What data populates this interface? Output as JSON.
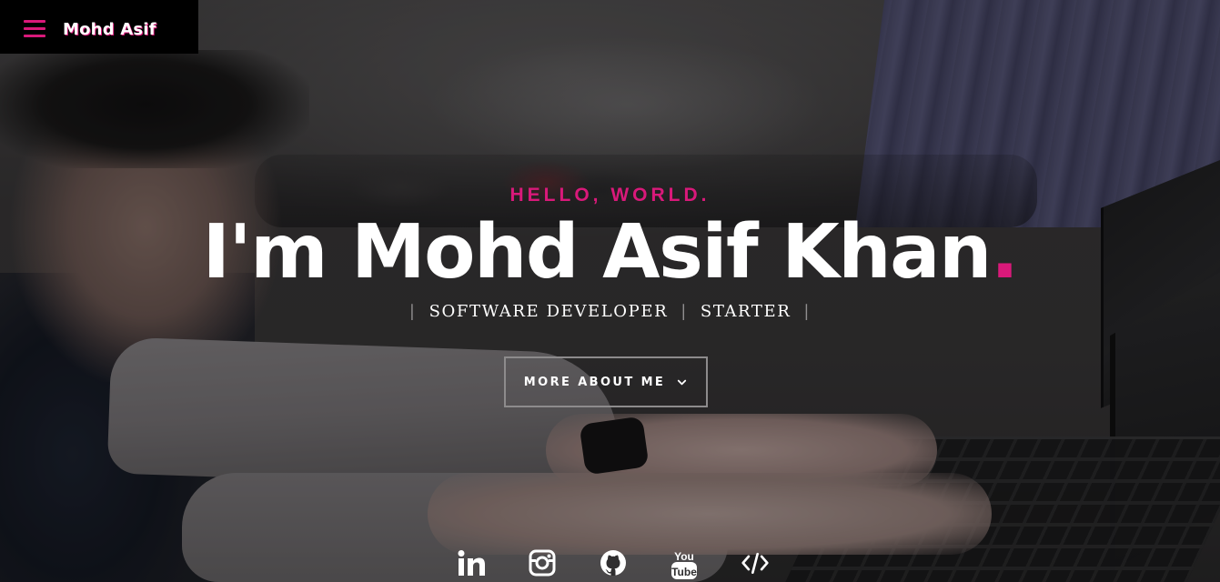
{
  "nav": {
    "brand": "Mohd Asif",
    "menu_icon": "hamburger-icon",
    "accent": "#d9197a"
  },
  "hero": {
    "greeting": "HELLO, WORLD.",
    "headline_name": "I'm Mohd Asif Khan",
    "headline_dot": ".",
    "roles": [
      "SOFTWARE DEVELOPER",
      "STARTER"
    ],
    "separator": "|",
    "more_button": "MORE ABOUT ME",
    "more_button_icon": "chevron-down-icon"
  },
  "socials": [
    {
      "name": "linkedin",
      "icon": "linkedin-icon"
    },
    {
      "name": "instagram",
      "icon": "instagram-icon"
    },
    {
      "name": "github",
      "icon": "github-icon"
    },
    {
      "name": "youtube",
      "icon": "youtube-icon",
      "label_top": "You",
      "label_bottom": "Tube"
    },
    {
      "name": "code",
      "icon": "code-icon"
    }
  ],
  "colors": {
    "accent": "#d9197a",
    "text": "#ffffff",
    "nav_bg": "#000000"
  }
}
